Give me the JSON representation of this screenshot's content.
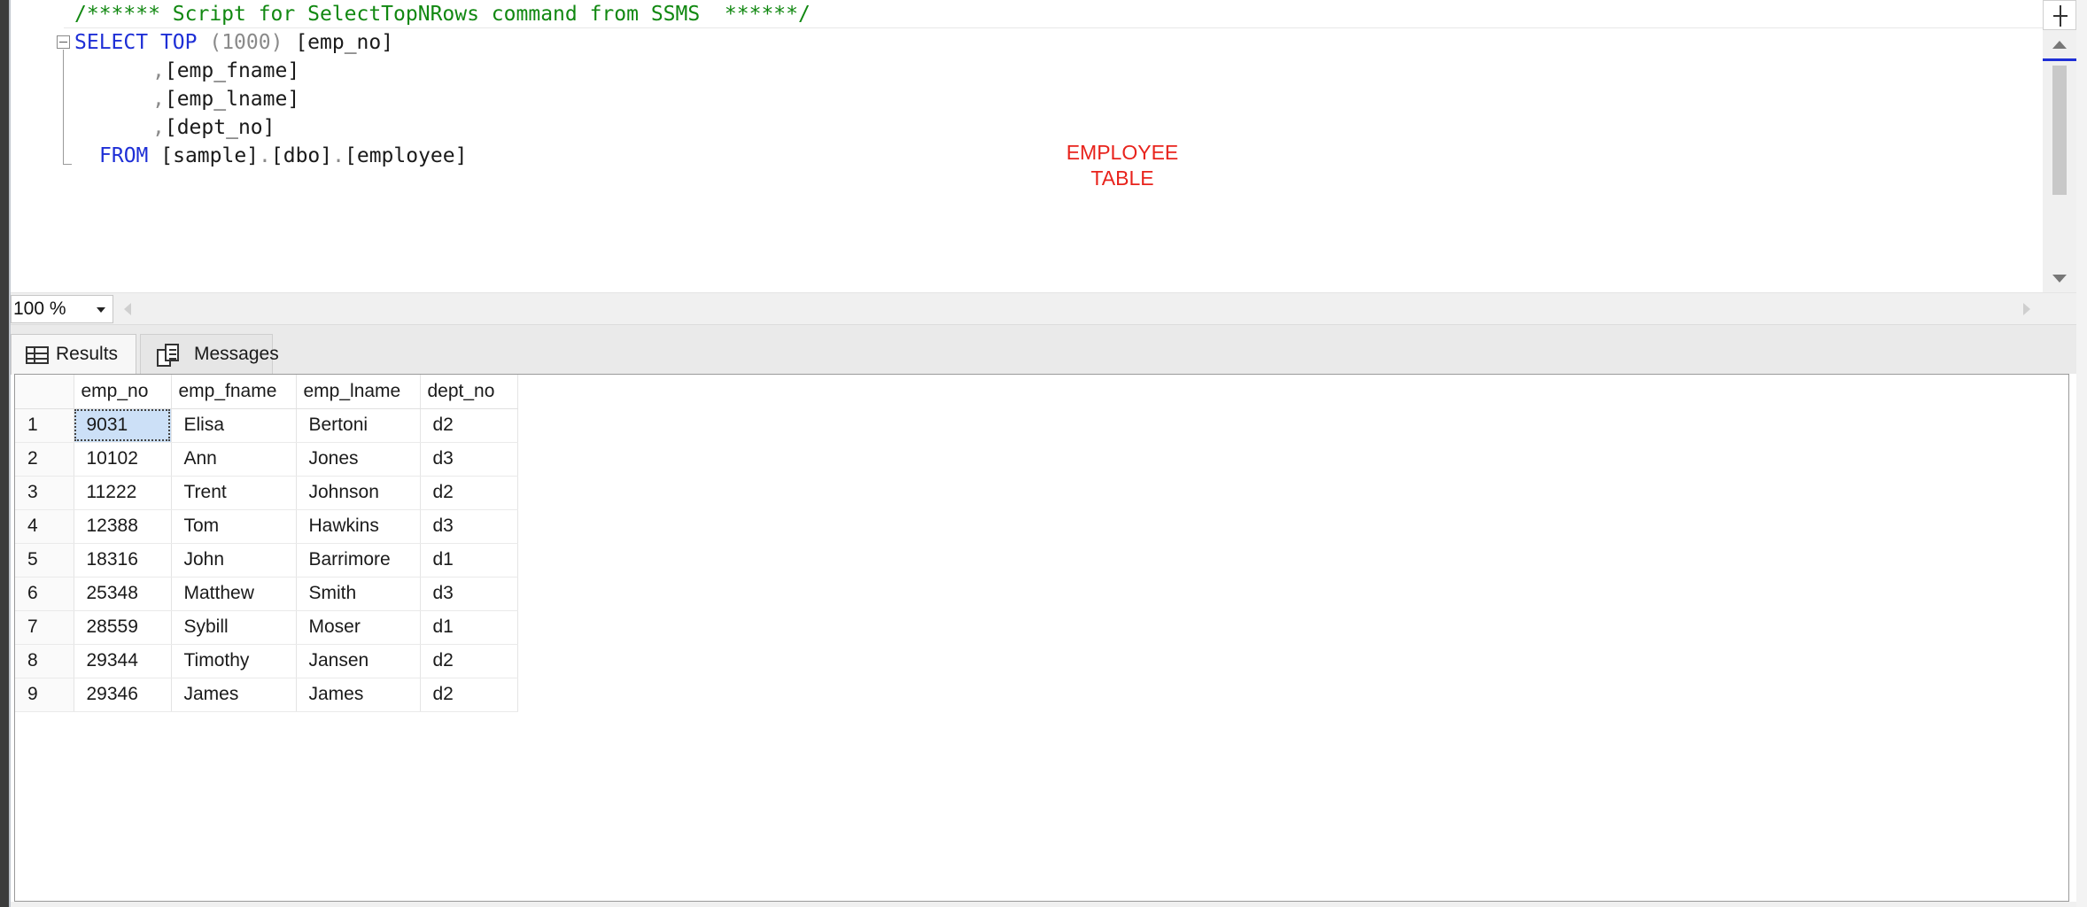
{
  "editor": {
    "lines": [
      "/****** Script for SelectTopNRows command from SSMS  ******/",
      "SELECT",
      "TOP",
      "(1000)",
      "[emp_no]",
      ",",
      "[emp_fname]",
      ",",
      "[emp_lname]",
      ",",
      "[dept_no]",
      "FROM",
      "[sample]",
      ".",
      "[dbo]",
      ".",
      "[employee]"
    ],
    "annotation_line1": "EMPLOYEE",
    "annotation_line2": "TABLE"
  },
  "zoom": {
    "value": "100 %"
  },
  "tabs": [
    {
      "label": "Results",
      "active": true
    },
    {
      "label": "Messages",
      "active": false
    }
  ],
  "grid": {
    "columns": [
      "emp_no",
      "emp_fname",
      "emp_lname",
      "dept_no"
    ],
    "rows": [
      {
        "n": "1",
        "cells": [
          "9031",
          "Elisa",
          "Bertoni",
          "d2"
        ]
      },
      {
        "n": "2",
        "cells": [
          "10102",
          "Ann",
          "Jones",
          "d3"
        ]
      },
      {
        "n": "3",
        "cells": [
          "11222",
          "Trent",
          "Johnson",
          "d2"
        ]
      },
      {
        "n": "4",
        "cells": [
          "12388",
          "Tom",
          "Hawkins",
          "d3"
        ]
      },
      {
        "n": "5",
        "cells": [
          "18316",
          "John",
          "Barrimore",
          "d1"
        ]
      },
      {
        "n": "6",
        "cells": [
          "25348",
          "Matthew",
          "Smith",
          "d3"
        ]
      },
      {
        "n": "7",
        "cells": [
          "28559",
          "Sybill",
          "Moser",
          "d1"
        ]
      },
      {
        "n": "8",
        "cells": [
          "29344",
          "Timothy",
          "Jansen",
          "d2"
        ]
      },
      {
        "n": "9",
        "cells": [
          "29346",
          "James",
          "James",
          "d2"
        ]
      }
    ]
  },
  "colors": {
    "comment": "#118811",
    "keyword": "#1e2fd6",
    "annotation": "#e8231c",
    "selected_cell": "#cce0f7"
  },
  "icons": {
    "splitter": "split-icon",
    "results_tab": "grid-icon",
    "messages_tab": "messages-icon"
  }
}
